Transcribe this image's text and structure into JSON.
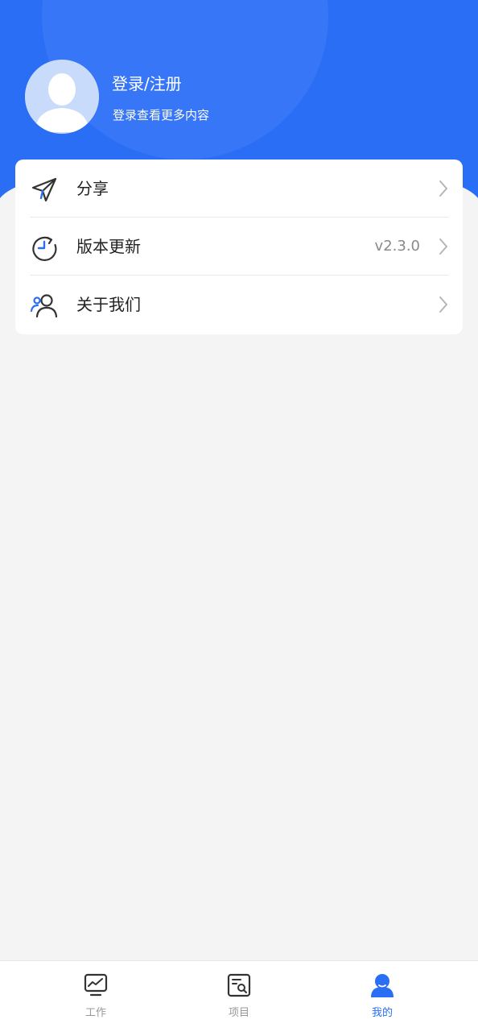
{
  "colors": {
    "primary": "#2b6ef6",
    "background": "#f4f4f4",
    "card": "#ffffff",
    "text": "#222222",
    "muted": "#8a8a8a",
    "tab_inactive": "#999999"
  },
  "profile": {
    "avatar_icon": "default-avatar-icon",
    "title": "登录/注册",
    "subtitle": "登录查看更多内容"
  },
  "menu": {
    "items": [
      {
        "icon": "paper-plane-icon",
        "label": "分享",
        "value": ""
      },
      {
        "icon": "refresh-clock-icon",
        "label": "版本更新",
        "value": "v2.3.0"
      },
      {
        "icon": "people-icon",
        "label": "关于我们",
        "value": ""
      }
    ]
  },
  "tabbar": {
    "active_index": 2,
    "items": [
      {
        "icon": "monitor-chart-icon",
        "label": "工作"
      },
      {
        "icon": "document-search-icon",
        "label": "项目"
      },
      {
        "icon": "user-icon",
        "label": "我的"
      }
    ]
  }
}
